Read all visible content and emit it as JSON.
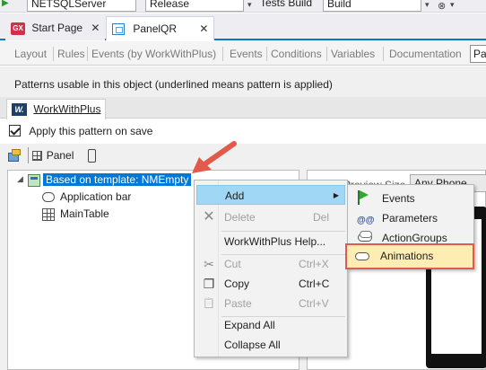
{
  "toolbar": {
    "server_combo": "NETSQLServer",
    "config_combo": "Release",
    "tests_label": "Tests Build",
    "build_combo": "Build"
  },
  "doc_tabs": [
    {
      "label": "Start Page",
      "close": "✕",
      "icon": "gx-icon"
    },
    {
      "label": "PanelQR",
      "close": "✕",
      "icon": "panel-icon"
    }
  ],
  "gx_icon_text": "GX",
  "sub_tabs": [
    "Layout",
    "Rules",
    "Events (by WorkWithPlus)",
    "Events",
    "Conditions",
    "Variables",
    "Documentation",
    "Pa"
  ],
  "info_text": "Patterns usable in this object (underlined means pattern is applied)",
  "pattern_tab": {
    "label": "WorkWithPlus",
    "logo_text": "W."
  },
  "apply_checkbox": {
    "label": "Apply this pattern on save",
    "checked": true
  },
  "panel_button": {
    "label": "Panel"
  },
  "tree": {
    "expand_glyph": "◢",
    "root": "Based on template: NMEmpty",
    "children": [
      "Application bar",
      "MainTable"
    ]
  },
  "preview": {
    "label": "Preview Size",
    "selected": "Any Phone"
  },
  "context_menu": {
    "items": [
      {
        "label": "Add",
        "shortcut": "",
        "submenu": "▶",
        "icon": "",
        "disabled": false,
        "highlight": true
      },
      {
        "label": "Delete",
        "shortcut": "Del",
        "icon": "✕",
        "disabled": true
      },
      {
        "label": "WorkWithPlus Help...",
        "shortcut": "",
        "icon": "",
        "disabled": false
      },
      {
        "label": "Cut",
        "shortcut": "Ctrl+X",
        "icon": "✂",
        "disabled": true
      },
      {
        "label": "Copy",
        "shortcut": "Ctrl+C",
        "icon": "❐",
        "disabled": false
      },
      {
        "label": "Paste",
        "shortcut": "Ctrl+V",
        "icon": "📋",
        "disabled": true
      },
      {
        "label": "Expand All",
        "shortcut": "",
        "icon": "",
        "disabled": false
      },
      {
        "label": "Collapse All",
        "shortcut": "",
        "icon": "",
        "disabled": false
      }
    ]
  },
  "submenu": {
    "items": [
      {
        "label": "Events",
        "icon": "flag-icon"
      },
      {
        "label": "Parameters",
        "icon": "parameters-icon",
        "glyph": "@@"
      },
      {
        "label": "ActionGroups",
        "icon": "action-groups-icon"
      },
      {
        "label": "Animations",
        "icon": "animations-icon"
      }
    ]
  },
  "colors": {
    "accent": "#007acc",
    "selection": "#0078d7",
    "menu_highlight": "#9fd7f5",
    "annotation_red": "#e25a4a",
    "animations_fill": "#fdedb3"
  }
}
